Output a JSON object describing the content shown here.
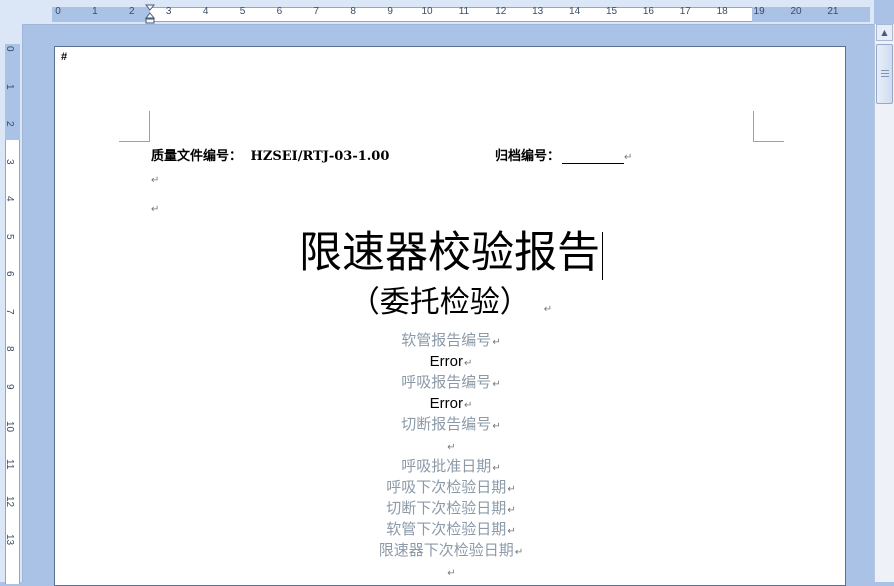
{
  "ruler": {
    "horizontal_numbers": [
      "0",
      "1",
      "2",
      "3",
      "4",
      "5",
      "6",
      "7",
      "8",
      "9",
      "10",
      "11",
      "12",
      "13",
      "14",
      "15",
      "16",
      "17",
      "18",
      "19",
      "20",
      "21"
    ],
    "vertical_numbers": [
      "0",
      "1",
      "2",
      "3",
      "4",
      "5",
      "6",
      "7",
      "8",
      "9",
      "10",
      "11",
      "12",
      "13"
    ]
  },
  "document": {
    "hash_mark": "#",
    "quality_file_label": "质量文件编号：",
    "quality_file_number": "HZSEI/RTJ-03-1.00",
    "archive_label": "归档编号：",
    "paragraph_mark": "↵",
    "title": "限速器校验报告",
    "subtitle": "（委托检验）",
    "fields": [
      {
        "text": "软管报告编号",
        "style": "gray"
      },
      {
        "text": "Error",
        "style": "black"
      },
      {
        "text": "呼吸报告编号",
        "style": "gray"
      },
      {
        "text": "Error",
        "style": "black"
      },
      {
        "text": "切断报告编号",
        "style": "gray"
      },
      {
        "text": "",
        "style": "gray"
      },
      {
        "text": "呼吸批准日期",
        "style": "gray"
      },
      {
        "text": "呼吸下次检验日期",
        "style": "gray"
      },
      {
        "text": "切断下次检验日期",
        "style": "gray"
      },
      {
        "text": "软管下次检验日期",
        "style": "gray"
      },
      {
        "text": "限速器下次检验日期",
        "style": "gray"
      },
      {
        "text": "",
        "style": "gray"
      }
    ]
  },
  "colors": {
    "app_background": "#a9c2e6",
    "field_placeholder": "#8c9aa8"
  }
}
